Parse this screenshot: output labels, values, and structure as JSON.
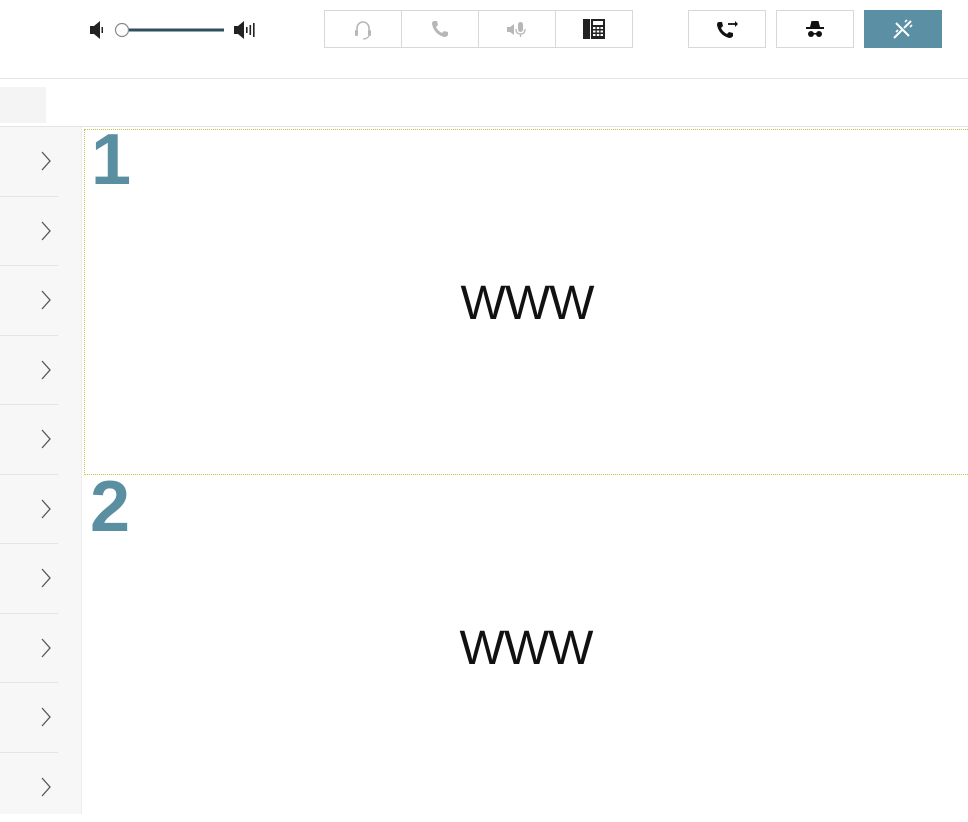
{
  "toolbar": {
    "volume": {
      "level": 0.0,
      "low_icon": "speaker-low-icon",
      "high_icon": "speaker-high-icon"
    },
    "call_controls": [
      {
        "name": "headset-icon",
        "enabled": false
      },
      {
        "name": "phone-icon",
        "enabled": false
      },
      {
        "name": "mic-mute-icon",
        "enabled": false
      },
      {
        "name": "keypad-icon",
        "enabled": true
      }
    ],
    "actions": [
      {
        "name": "call-transfer-icon",
        "enabled": true
      },
      {
        "name": "incognito-icon",
        "enabled": true
      },
      {
        "name": "disconnect-icon",
        "enabled": true,
        "active": true
      }
    ],
    "accent_color": "#5b8fa3"
  },
  "sidebar": {
    "items": [
      {
        "icon": "chevron-right-icon"
      },
      {
        "icon": "chevron-right-icon"
      },
      {
        "icon": "chevron-right-icon"
      },
      {
        "icon": "chevron-right-icon"
      },
      {
        "icon": "chevron-right-icon"
      },
      {
        "icon": "chevron-right-icon"
      },
      {
        "icon": "chevron-right-icon"
      },
      {
        "icon": "chevron-right-icon"
      },
      {
        "icon": "chevron-right-icon"
      },
      {
        "icon": "chevron-right-icon"
      }
    ]
  },
  "panes": [
    {
      "number": "1",
      "text": "WWW",
      "selected": true
    },
    {
      "number": "2",
      "text": "WWW",
      "selected": false
    }
  ],
  "colors": {
    "pane_number": "#5a8ea1",
    "selection_border": "#c9c24a"
  }
}
